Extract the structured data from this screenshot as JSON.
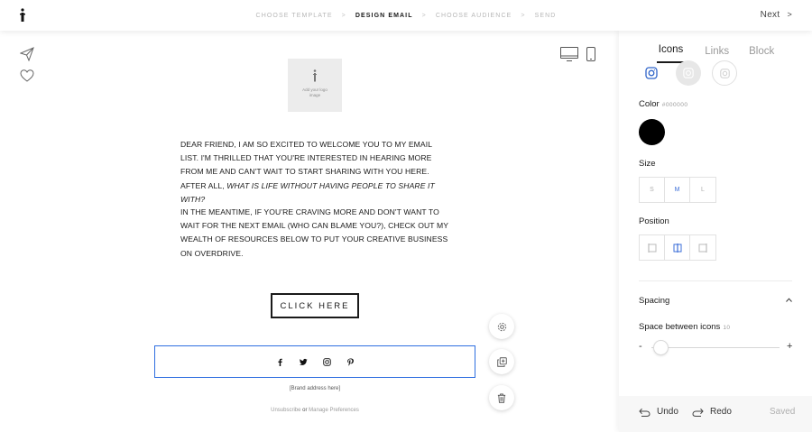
{
  "app": {
    "brand_glyph": "f"
  },
  "topbar": {
    "steps": [
      {
        "label": "CHOOSE TEMPLATE",
        "active": false
      },
      {
        "label": "DESIGN EMAIL",
        "active": true
      },
      {
        "label": "CHOOSE AUDIENCE",
        "active": false
      },
      {
        "label": "SEND",
        "active": false
      }
    ],
    "step_separator": ">",
    "next_label": "Next",
    "next_arrow": ">"
  },
  "left_rail": {
    "icons": [
      "send-icon",
      "heart-icon"
    ]
  },
  "canvas": {
    "view_toggles": [
      "desktop-icon",
      "mobile-icon"
    ],
    "logo_placeholder": {
      "glyph": "f",
      "text": "Add your logo image"
    },
    "paragraph1_plain": "DEAR FRIEND, I AM SO EXCITED TO WELCOME YOU TO MY EMAIL LIST. I'M THRILLED THAT YOU'RE INTERESTED IN HEARING MORE FROM ME AND CAN'T WAIT TO START SHARING WITH YOU HERE. AFTER ALL, ",
    "paragraph1_italic": "WHAT IS LIFE WITHOUT HAVING PEOPLE TO SHARE IT WITH?",
    "paragraph2": "IN THE MEANTIME, IF YOU'RE CRAVING MORE AND DON'T WANT TO WAIT FOR THE NEXT EMAIL (WHO CAN BLAME YOU?), CHECK OUT MY WEALTH OF RESOURCES BELOW TO PUT YOUR CREATIVE BUSINESS ON OVERDRIVE.",
    "cta_label": "CLICK HERE",
    "social_icons": [
      "facebook-icon",
      "twitter-icon",
      "instagram-icon",
      "pinterest-icon"
    ],
    "brand_address": "[Brand address here]",
    "unsubscribe": "Unsubscribe",
    "or": "or",
    "manage_prefs": "Manage Preferences",
    "floating_tools": [
      "settings-icon",
      "duplicate-icon",
      "trash-icon"
    ],
    "selection_color": "#2e6ee0"
  },
  "panel": {
    "tabs": [
      {
        "label": "Icons",
        "active": true
      },
      {
        "label": "Links",
        "active": false
      },
      {
        "label": "Block",
        "active": false
      }
    ],
    "icon_styles": [
      "instagram-outline-icon",
      "instagram-filled-circle-icon",
      "instagram-outlined-circle-icon"
    ],
    "color_label": "Color",
    "color_hex": "#000000",
    "color_value": "#000000",
    "size_label": "Size",
    "sizes": [
      {
        "label": "S",
        "active": false
      },
      {
        "label": "M",
        "active": true
      },
      {
        "label": "L",
        "active": false
      }
    ],
    "position_label": "Position",
    "positions": [
      {
        "icon": "align-left-icon",
        "active": false
      },
      {
        "icon": "align-center-icon",
        "active": true
      },
      {
        "icon": "align-right-icon",
        "active": false
      }
    ],
    "spacing_label": "Spacing",
    "space_between_label": "Space between icons",
    "space_between_value": "10",
    "slider_minus": "-",
    "slider_plus": "+",
    "undo_label": "Undo",
    "redo_label": "Redo",
    "saved_label": "Saved"
  }
}
